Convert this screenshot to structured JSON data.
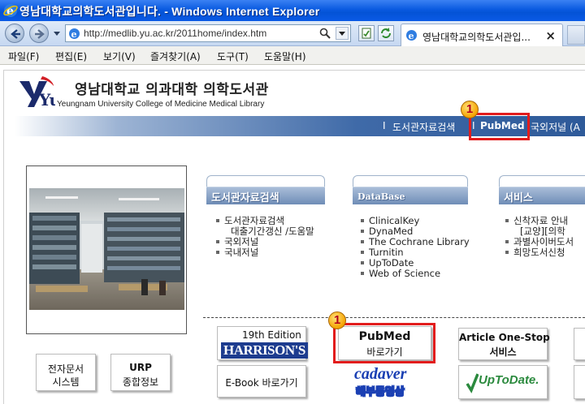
{
  "window": {
    "title": "영남대학교의학도서관입니다. - Windows Internet Explorer"
  },
  "browser": {
    "url": "http://medlib.yu.ac.kr/2011home/index.htm",
    "tab_label": "영남대학교의학도서관입...",
    "tab_close": "×"
  },
  "menu": [
    "파일(F)",
    "편집(E)",
    "보기(V)",
    "즐겨찾기(A)",
    "도구(T)",
    "도움말(H)"
  ],
  "header": {
    "logo_text": "Yu",
    "title_ko": "영남대학교 의과대학 의학도서관",
    "title_en": "Yeungnam University College of Medicine Medical Library"
  },
  "topnav": {
    "sep": "I",
    "links": [
      "도서관자료검색",
      "PubMed",
      "국외저널 (A"
    ]
  },
  "annotation": {
    "badge": "1",
    "color": "#e21c1c"
  },
  "panels": [
    {
      "title": "도서관자료검색",
      "items": [
        {
          "text": "도서관자료검색",
          "bullet": true
        },
        {
          "text": "대출기간갱신 /도움말",
          "bullet": false
        },
        {
          "text": "국외저널",
          "bullet": true
        },
        {
          "text": "국내저널",
          "bullet": true
        }
      ]
    },
    {
      "title": "DataBase",
      "items": [
        {
          "text": "ClinicalKey",
          "bullet": true
        },
        {
          "text": "DynaMed",
          "bullet": true
        },
        {
          "text": "The Cochrane Library",
          "bullet": true
        },
        {
          "text": "Turnitin",
          "bullet": true
        },
        {
          "text": "UpToDate",
          "bullet": true
        },
        {
          "text": "Web of Science",
          "bullet": true
        }
      ]
    },
    {
      "title": "서비스",
      "items": [
        {
          "text": "신착자료 안내",
          "bullet": true
        },
        {
          "text": "[교양][의학",
          "bullet": false
        },
        {
          "text": "과별사이버도서",
          "bullet": true
        },
        {
          "text": "희망도서신청",
          "bullet": true
        }
      ]
    }
  ],
  "buttons": {
    "ebook_system": [
      "전자문서",
      "시스템"
    ],
    "urp": [
      "URP",
      "종합정보"
    ],
    "harrison_edition": "19th Edition",
    "harrison_name": "HARRISON'S",
    "pubmed_title": "PubMed",
    "pubmed_sub": "바로가기",
    "article_title": "Article One-Stop",
    "article_sub": "서비스",
    "ebook_link": "E-Book 바로가기",
    "cadaver_title": "cadaver",
    "cadaver_sub": "해부동영상",
    "uptodate": "UpToDate."
  },
  "colors": {
    "nav_blue": "#2e5a99",
    "panel_bar": "#6f8db7",
    "logo_red": "#d21f26",
    "logo_navy": "#1b2a6b",
    "cadaver_blue": "#1a3fb3",
    "uptodate_green": "#2b8a3e"
  }
}
